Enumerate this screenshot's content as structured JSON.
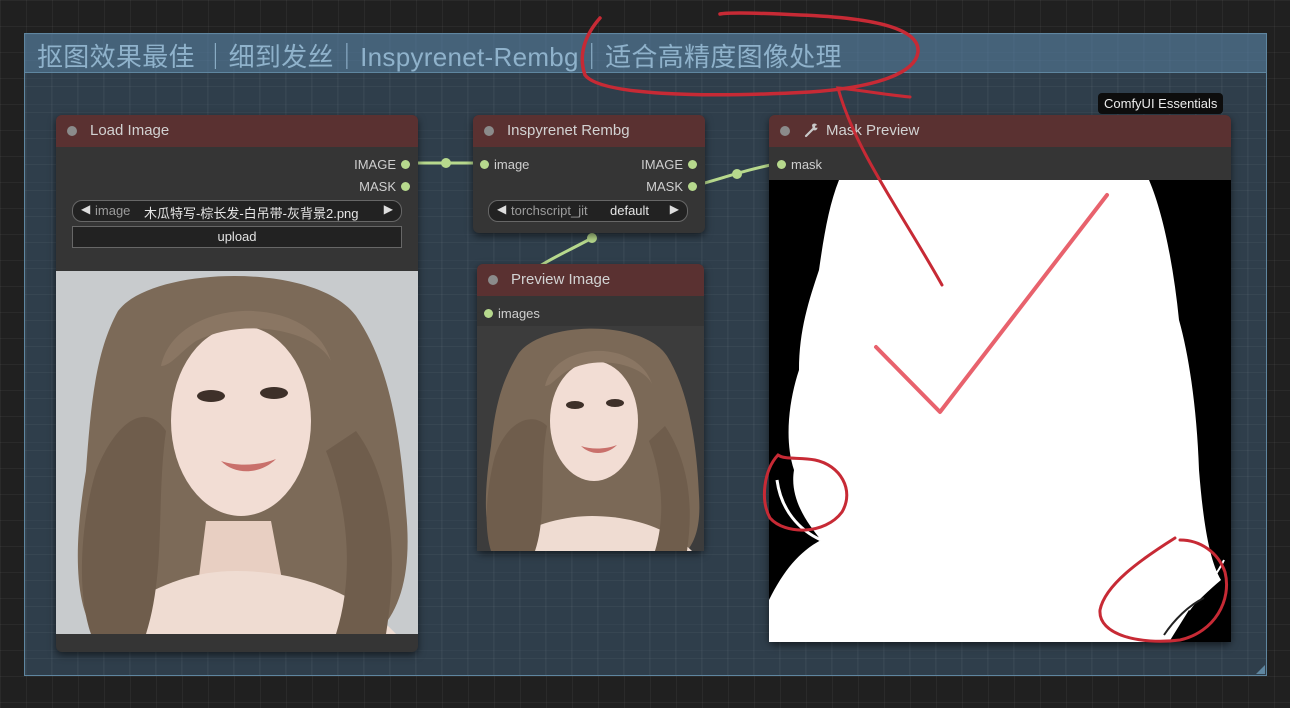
{
  "group": {
    "title": "抠图效果最佳 ｜细到发丝｜Inspyrenet-Rembg｜适合高精度图像处理"
  },
  "tag": {
    "label": "ComfyUI Essentials"
  },
  "nodes": {
    "load_image": {
      "title": "Load Image",
      "outputs": [
        "IMAGE",
        "MASK"
      ],
      "widget": {
        "label": "image",
        "value": "木瓜特写-棕长发-白吊带-灰背景2.png"
      },
      "upload_label": "upload"
    },
    "rembg": {
      "title": "Inspyrenet Rembg",
      "input": "image",
      "outputs": [
        "IMAGE",
        "MASK"
      ],
      "widget": {
        "label": "torchscript_jit",
        "value": "default"
      }
    },
    "preview": {
      "title": "Preview Image",
      "input": "images"
    },
    "mask_preview": {
      "title": "Mask Preview",
      "input": "mask",
      "icon": "wrench-icon"
    }
  },
  "colors": {
    "node_header": "#5a3131",
    "node_body": "#353535",
    "group_border": "#5f86a0",
    "link": "#b7d98d",
    "annotation": "#e0606b"
  }
}
